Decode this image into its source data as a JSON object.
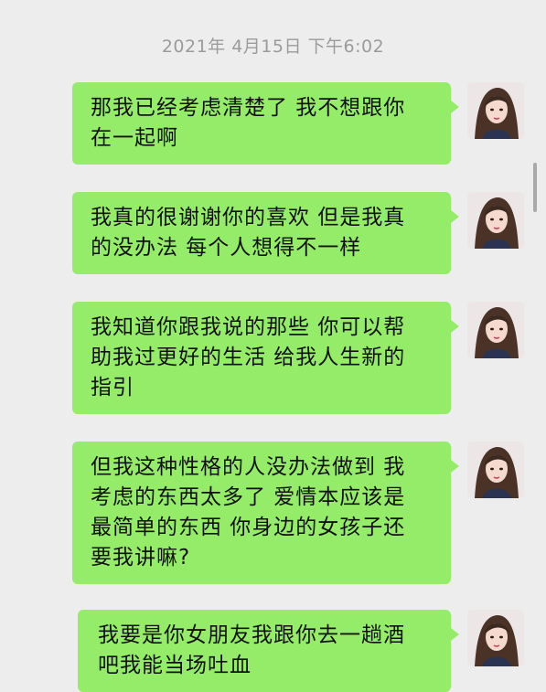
{
  "chat": {
    "timestamp": "2021年 4月15日 下午6:02",
    "messages": [
      {
        "line1": "那我已经考虑清楚了 我不想跟你",
        "line2": "在一起啊",
        "line3": "",
        "line4": ""
      },
      {
        "line1": "我真的很谢谢你的喜欢 但是我真",
        "line2": "的没办法 每个人想得不一样",
        "line3": "",
        "line4": ""
      },
      {
        "line1": "我知道你跟我说的那些 你可以帮",
        "line2": "助我过更好的生活 给我人生新的",
        "line3": "指引",
        "line4": ""
      },
      {
        "line1": "但我这种性格的人没办法做到 我",
        "line2": "考虑的东西太多了 爱情本应该是",
        "line3": "最简单的东西 你身边的女孩子还",
        "line4": "要我讲嘛?"
      },
      {
        "line1": "我要是你女朋友我跟你去一趟酒",
        "line2": "吧我能当场吐血",
        "line3": "",
        "line4": ""
      }
    ]
  },
  "colors": {
    "background": "#ededed",
    "bubble": "#95ec69",
    "timestamp": "#9b9b9b"
  },
  "icons": {
    "avatar": "avatar-girl-photo"
  }
}
